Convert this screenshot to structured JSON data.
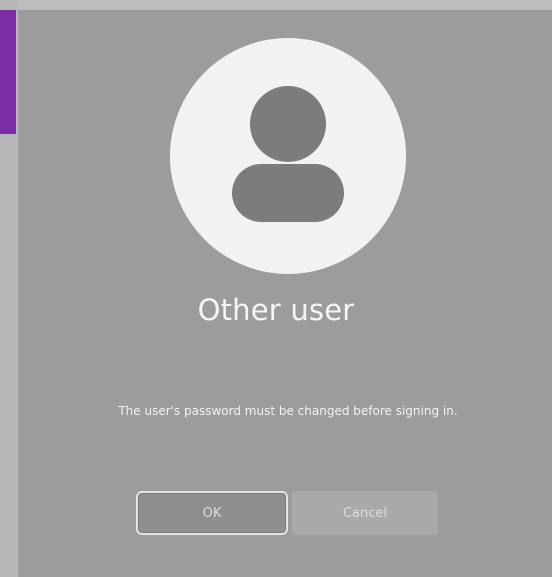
{
  "user": {
    "name": "Other user",
    "avatar_icon": "person-icon"
  },
  "message": "The user's password must be changed before signing in.",
  "buttons": {
    "ok_label": "OK",
    "cancel_label": "Cancel"
  },
  "colors": {
    "accent": "#7a2fa8",
    "background": "#9c9c9c",
    "avatar_bg": "#f2f2f2",
    "avatar_fg": "#7c7c7c"
  }
}
